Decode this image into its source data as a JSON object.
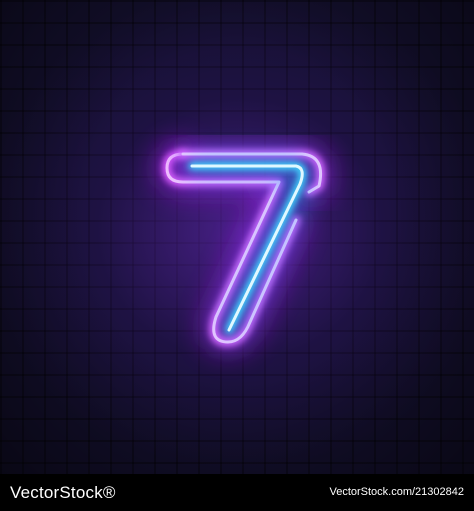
{
  "image": {
    "digit": "7",
    "colors": {
      "outer_tube": "#d43cff",
      "inner_tube": "#3fd8ff",
      "wall": "#14102e",
      "glow": "#732dd2"
    }
  },
  "footer": {
    "brand": "VectorStock",
    "brand_mark": "®",
    "image_id": "VectorStock.com/21302842"
  }
}
